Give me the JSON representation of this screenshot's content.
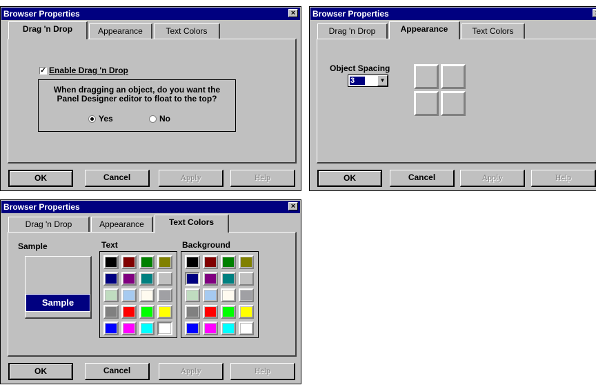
{
  "title": "Browser Properties",
  "close_glyph": "×",
  "tabs": [
    "Drag 'n Drop",
    "Appearance",
    "Text Colors"
  ],
  "buttons": {
    "ok": "OK",
    "cancel": "Cancel",
    "apply": "Apply",
    "help": "Help"
  },
  "dragdrop": {
    "enable_label": "Enable Drag 'n Drop",
    "enable_checked": true,
    "check_glyph": "✓",
    "question_line1": "When dragging an object, do you want the",
    "question_line2": "Panel Designer editor to float to the top?",
    "yes_label": "Yes",
    "no_label": "No",
    "selected": "Yes"
  },
  "appearance": {
    "spacing_label": "Object Spacing",
    "spacing_value": "3",
    "arrow_glyph": "▼"
  },
  "textcolors": {
    "sample_heading": "Sample",
    "sample_text": "Sample",
    "text_heading": "Text",
    "background_heading": "Background",
    "palette_colors": [
      [
        "#000000",
        "#800000",
        "#008000",
        "#808000"
      ],
      [
        "#000080",
        "#800080",
        "#008080",
        "#c0c0c0"
      ],
      [
        "#c0dcc0",
        "#a6caf0",
        "#fffbf0",
        "#a0a0a4"
      ],
      [
        "#808080",
        "#ff0000",
        "#00ff00",
        "#ffff00"
      ],
      [
        "#0000ff",
        "#ff00ff",
        "#00ffff",
        "#ffffff"
      ]
    ],
    "text_selected": "#ffffff",
    "background_selected": "#000080"
  }
}
